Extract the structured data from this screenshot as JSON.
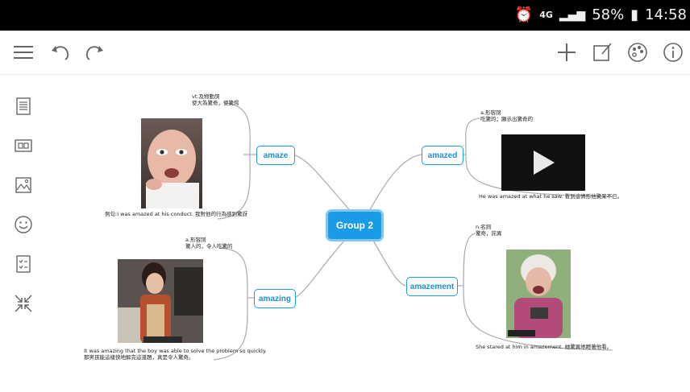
{
  "status": {
    "network": "4G",
    "battery": "58%",
    "time": "14:58"
  },
  "toolbar": {
    "left_icons": [
      "menu-icon",
      "undo-icon",
      "redo-icon"
    ],
    "right_icons": [
      "plus-icon",
      "edit-box-icon",
      "theme-icon",
      "info-icon"
    ]
  },
  "sidebar": {
    "icons": [
      "outline-icon",
      "presentation-icon",
      "image-icon",
      "emoji-icon",
      "checklist-icon",
      "collapse-icon"
    ]
  },
  "mindmap": {
    "central": "Group 2",
    "topics": {
      "amaze": {
        "label": "amaze",
        "pos": "vt.及物動詞",
        "meaning": "使大為驚奇，使驚愕",
        "example": "例句:I was amazed at his conduct. 我對他的行為感到驚訝"
      },
      "amazed": {
        "label": "amazed",
        "pos": "a.形容詞",
        "meaning": "吃驚的；顯示出驚奇的",
        "example": "He was amazed at what he saw. 看到這情形他驚呆不已。"
      },
      "amazing": {
        "label": "amazing",
        "pos": "a.形容詞",
        "meaning": "驚人的，令人吃驚的",
        "example_line1": "It was amazing that the boy was able to solve the problem so quickly.",
        "example_line2": "那男孩能這樣快地解完這道題，真是令人驚奇。"
      },
      "amazement": {
        "label": "amazement",
        "pos": "n.名詞",
        "meaning": "驚奇，詫異",
        "example": "She stared at him in amazement. 她驚異地瞪著他看。"
      }
    }
  },
  "colors": {
    "accent": "#1a9be6",
    "central_fill": "#1a9be6",
    "link": "#a9b1b7"
  }
}
